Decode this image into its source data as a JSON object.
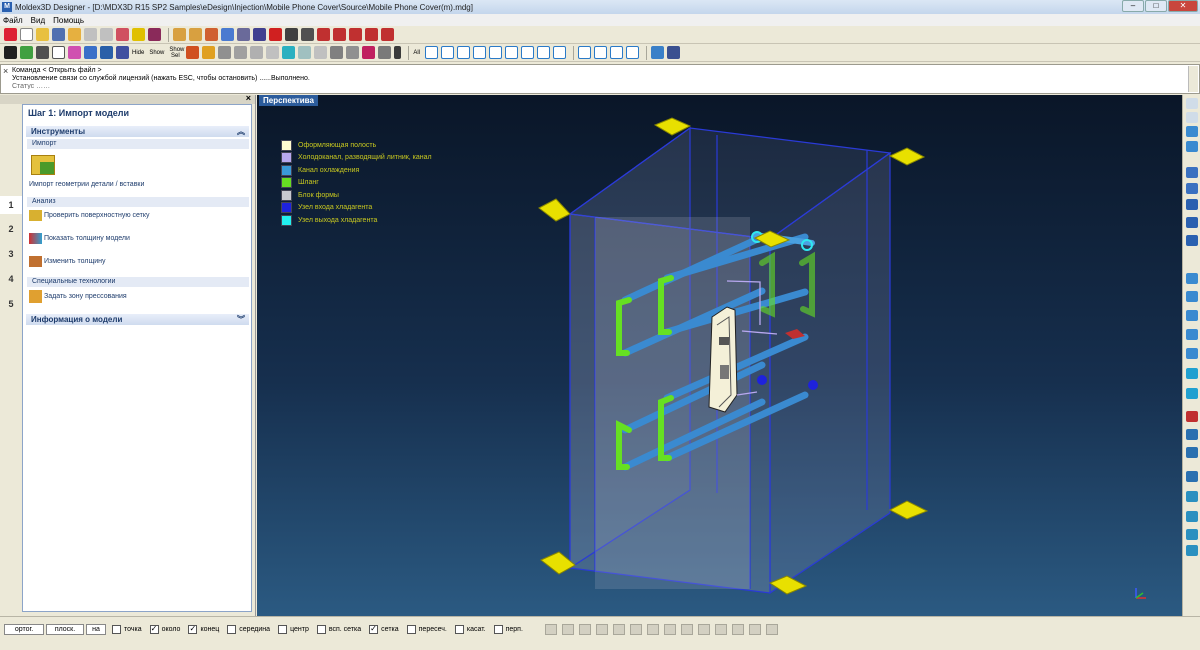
{
  "window": {
    "title": "Moldex3D Designer - [D:\\MDX3D R15 SP2 Samples\\eDesign\\Injection\\Mobile Phone Cover\\Source\\Mobile Phone Cover(m).mdg]"
  },
  "menu": [
    "Файл",
    "Вид",
    "Помощь"
  ],
  "toolbar": {
    "hide_label": "Hide",
    "show_label": "Show",
    "show_sel_label": "Show Sel",
    "all_label": "All"
  },
  "command": {
    "close": "×",
    "line1": "Команда < Открыть файл >",
    "line2": "Установление связи со службой лицензий (нажать ESC, чтобы остановить) ......Выполнено.",
    "line3": "Статус ……"
  },
  "panel": {
    "close": "×",
    "step_title": "Шаг 1: Импорт модели",
    "tools_header": "Инструменты",
    "import_section": "Импорт",
    "import_item": "Импорт геометрии детали / вставки",
    "analysis_section": "Анализ",
    "analysis_items": [
      "Проверить поверхностную сетку",
      "Показать толщину модели",
      "Изменить толщину"
    ],
    "special_section": "Специальные технологии",
    "special_item": "Задать зону прессования",
    "info_header": "Информация о модели",
    "steps": [
      "1",
      "2",
      "3",
      "4",
      "5"
    ]
  },
  "viewport": {
    "title": "Перспектива",
    "legend": [
      {
        "label": "Оформляющая полость",
        "color": "#fffbd0"
      },
      {
        "label": "Холодоканал, разводящий литник, канал",
        "color": "#b8a8f0"
      },
      {
        "label": "Канал охлаждения",
        "color": "#3a9ad8"
      },
      {
        "label": "Шланг",
        "color": "#66dd22"
      },
      {
        "label": "Блок формы",
        "color": "#c8c8d0"
      },
      {
        "label": "Узел входа хладагента",
        "color": "#1e22dd"
      },
      {
        "label": "Узел выхода хладагента",
        "color": "#22f0f0"
      }
    ]
  },
  "status": {
    "ortho_label": "ортог.",
    "planar_label": "плоск.",
    "on_label": "на",
    "snaps": [
      {
        "label": "точка",
        "checked": false
      },
      {
        "label": "около",
        "checked": true
      },
      {
        "label": "конец",
        "checked": true
      },
      {
        "label": "середина",
        "checked": false
      },
      {
        "label": "центр",
        "checked": false
      },
      {
        "label": "всп. сетка",
        "checked": false
      },
      {
        "label": "сетка",
        "checked": true
      },
      {
        "label": "пересеч.",
        "checked": false
      },
      {
        "label": "касат.",
        "checked": false
      },
      {
        "label": "перп.",
        "checked": false
      }
    ]
  }
}
